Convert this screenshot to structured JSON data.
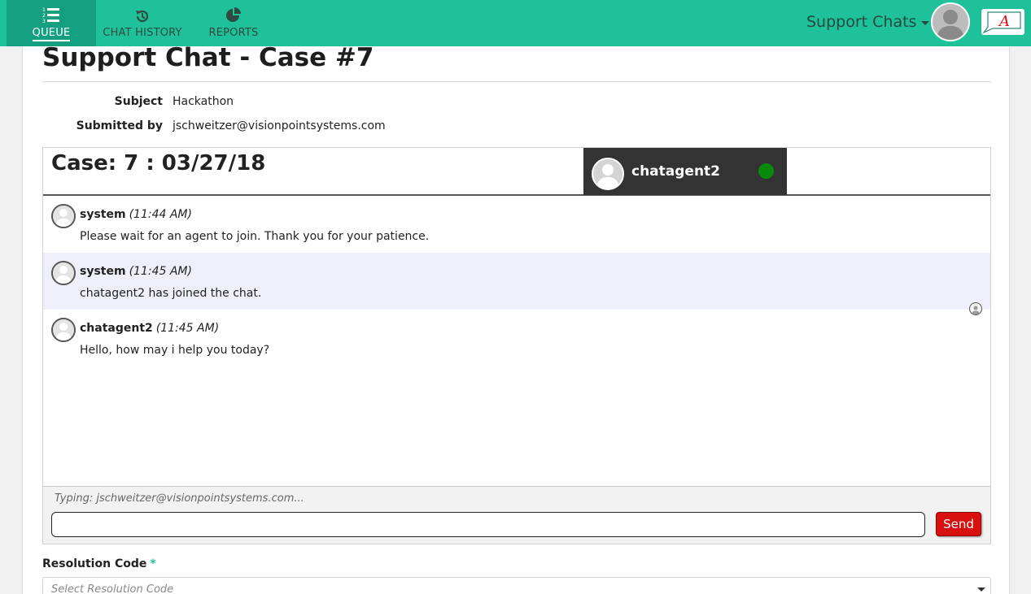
{
  "nav": {
    "items": [
      {
        "label": "QUEUE",
        "icon": "numbered-list-icon",
        "active": true
      },
      {
        "label": "CHAT HISTORY",
        "icon": "history-icon",
        "active": false
      },
      {
        "label": "REPORTS",
        "icon": "pie-chart-icon",
        "active": false
      }
    ],
    "app_switcher": "Support Chats",
    "logo_letter": "A"
  },
  "page": {
    "title": "Support Chat - Case #7",
    "subject_label": "Subject",
    "subject_value": "Hackathon",
    "submitted_label": "Submitted by",
    "submitted_value": "jschweitzer@visionpointsystems.com"
  },
  "chat": {
    "case_title": "Case: 7 : 03/27/18",
    "agent_name": "chatagent2",
    "agent_status_color": "#0a8a0a",
    "messages": [
      {
        "author": "system",
        "time": "(11:44 AM)",
        "text": "Please wait for an agent to join. Thank you for your patience."
      },
      {
        "author": "system",
        "time": "(11:45 AM)",
        "text": "chatagent2 has joined the chat."
      },
      {
        "author": "chatagent2",
        "time": "(11:45 AM)",
        "text": "Hello, how may i help you today?"
      }
    ],
    "typing": "Typing: jschweitzer@visionpointsystems.com...",
    "input_value": "",
    "send_label": "Send"
  },
  "resolution": {
    "label": "Resolution Code",
    "required_marker": "*",
    "placeholder": "Select Resolution Code"
  },
  "colors": {
    "brand": "#1ec19a",
    "brand_dark": "#14a080",
    "send": "#d80f0f"
  }
}
